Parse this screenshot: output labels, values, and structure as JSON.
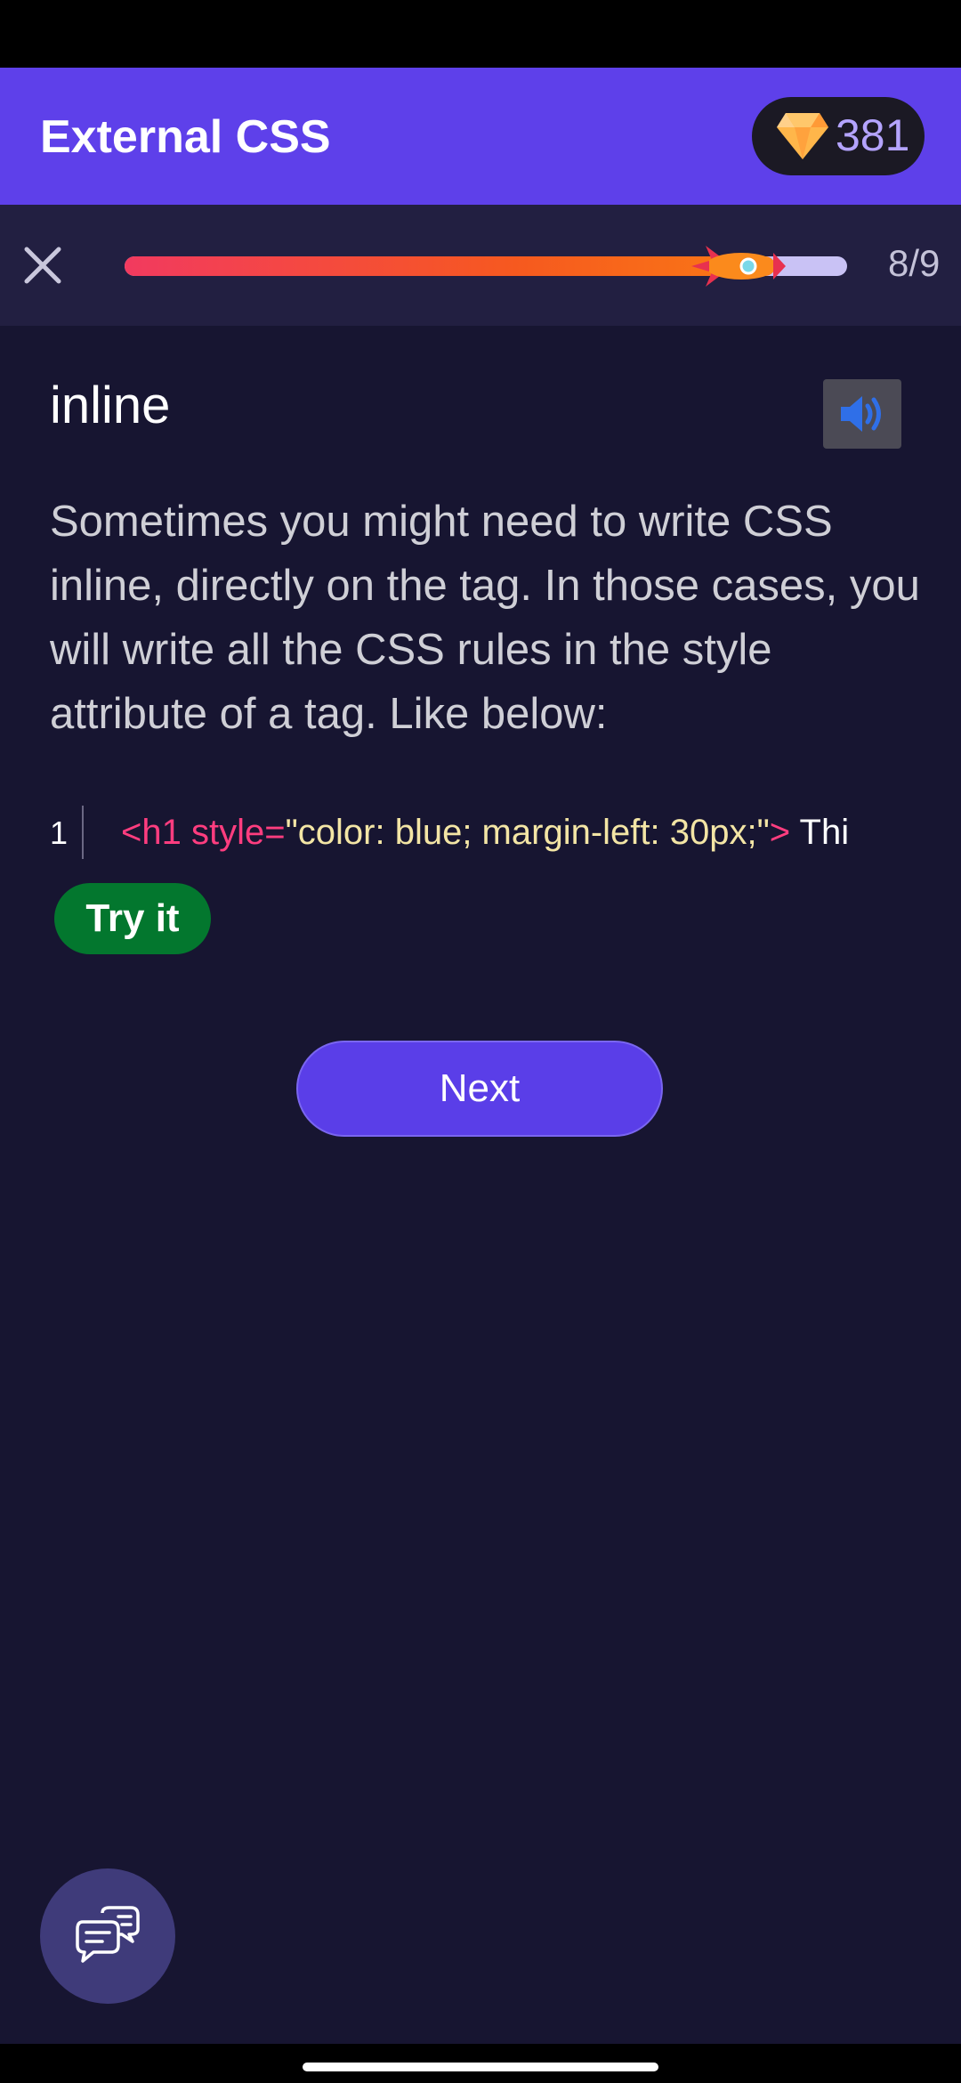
{
  "header": {
    "title": "External CSS",
    "gems": "381",
    "gem_icon": "diamond-icon"
  },
  "progress": {
    "current": 8,
    "total": 9,
    "label": "8/9",
    "fraction": 0.9,
    "close_icon": "close-icon",
    "marker_icon": "rocket-icon"
  },
  "lesson": {
    "title": "inline",
    "sound_icon": "speaker-icon",
    "text": "Sometimes you might need to write CSS inline, directly on the tag. In those cases, you will write all the CSS rules in the style attribute of a tag. Like below:"
  },
  "code": {
    "line_number": "1",
    "tokens": {
      "open_tag": "<h1 style=",
      "attr_value": "\"color: blue; margin-left: 30px;\"",
      "close_bracket": ">",
      "content": " Thi"
    }
  },
  "buttons": {
    "try_it": "Try it",
    "next": "Next"
  },
  "chat": {
    "icon": "chat-bubbles-icon"
  },
  "colors": {
    "header_bg": "#5e40ea",
    "page_bg": "#171531",
    "try_green": "#03772e",
    "tag_pink": "#ff3d7f",
    "string_yellow": "#f3e5a5"
  }
}
